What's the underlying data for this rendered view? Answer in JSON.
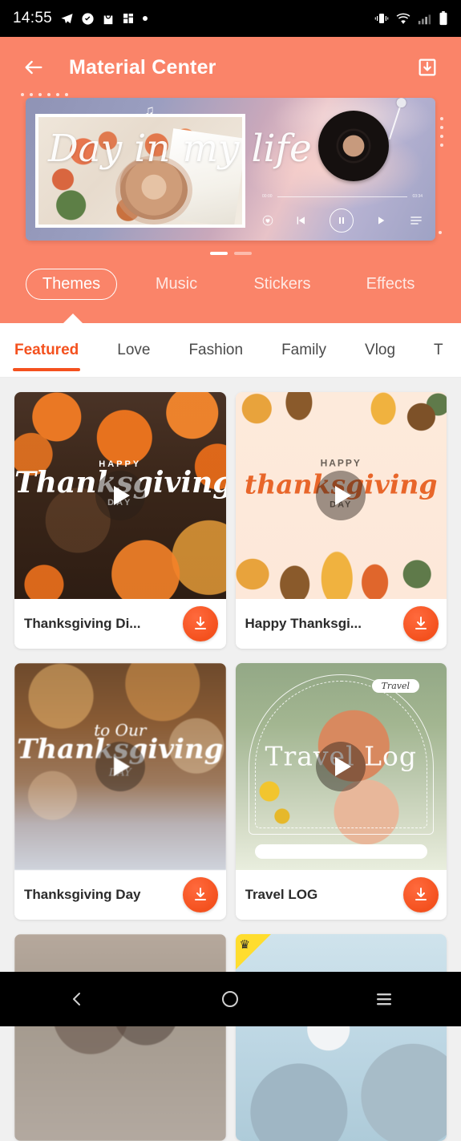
{
  "status_bar": {
    "time": "14:55",
    "left_icons": [
      "telegram-icon",
      "check-circle-icon",
      "shopping-bag-icon",
      "apps-icon",
      "dot-icon"
    ],
    "right_icons": [
      "vibrate-icon",
      "wifi-icon",
      "signal-icon",
      "battery-icon"
    ]
  },
  "header": {
    "title": "Material Center",
    "back_icon": "back-arrow-icon",
    "download_icon": "download-icon",
    "background_color": "#fa8469"
  },
  "banner": {
    "title_script": "Day in my life",
    "time_elapsed": "00:00",
    "time_total": "03:34",
    "controls": [
      "heart-icon",
      "previous-icon",
      "pause-icon",
      "next-icon",
      "playlist-icon"
    ],
    "pages": 2,
    "active_page": 1
  },
  "main_tabs": [
    {
      "label": "Themes",
      "active": true
    },
    {
      "label": "Music",
      "active": false
    },
    {
      "label": "Stickers",
      "active": false
    },
    {
      "label": "Effects",
      "active": false
    }
  ],
  "sub_tabs": [
    {
      "label": "Featured",
      "active": true
    },
    {
      "label": "Love",
      "active": false
    },
    {
      "label": "Fashion",
      "active": false
    },
    {
      "label": "Family",
      "active": false
    },
    {
      "label": "Vlog",
      "active": false
    },
    {
      "label": "T",
      "active": false
    }
  ],
  "accent_color": "#f4511e",
  "cards": [
    {
      "title": "Thanksgiving Di...",
      "overlay_top": "HAPPY",
      "overlay_main": "Thanksgiving",
      "overlay_bottom": "DAY",
      "play_icon": "play-icon",
      "download_icon": "download-icon",
      "vip": false
    },
    {
      "title": "Happy Thanksgi...",
      "overlay_top": "HAPPY",
      "overlay_main": "thanksgiving",
      "overlay_bottom": "DAY",
      "play_icon": "play-icon",
      "download_icon": "download-icon",
      "vip": false
    },
    {
      "title": "Thanksgiving Day",
      "overlay_top": "to Our",
      "overlay_main": "Thanksgiving",
      "overlay_bottom": "DAY",
      "play_icon": "play-icon",
      "download_icon": "download-icon",
      "vip": false
    },
    {
      "title": "Travel LOG",
      "overlay_top": "Travel",
      "overlay_main": "Travel Log",
      "overlay_bottom": "",
      "play_icon": "play-icon",
      "download_icon": "download-icon",
      "vip": false
    }
  ],
  "partial_cards": [
    {
      "vip": false
    },
    {
      "vip": true,
      "badge_icon": "crown-icon"
    }
  ],
  "nav_bar": {
    "back_icon": "nav-back-icon",
    "home_icon": "nav-home-icon",
    "recents_icon": "nav-recents-icon"
  }
}
